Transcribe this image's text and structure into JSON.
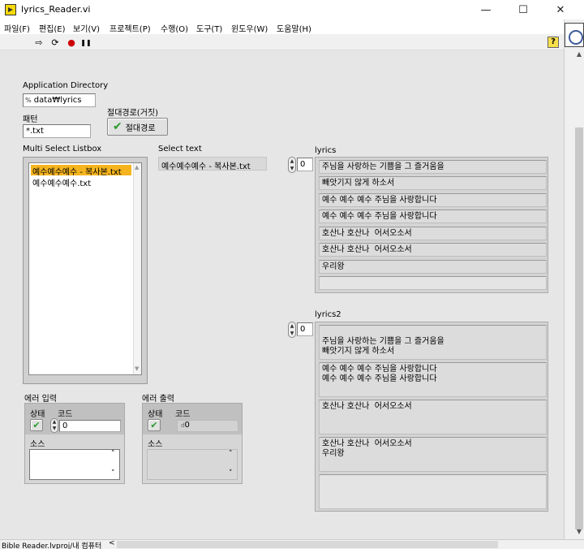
{
  "window": {
    "title": "lyrics_Reader.vi",
    "minimize": "—",
    "maximize": "☐",
    "close": "✕"
  },
  "menu": [
    "파일(F)",
    "편집(E)",
    "보기(V)",
    "프로젝트(P)",
    "수행(O)",
    "도구(T)",
    "윈도우(W)",
    "도움말(H)"
  ],
  "toolbar": {
    "run": "⇨",
    "run_continuous": "⟳",
    "abort": "●",
    "pause": "❚❚"
  },
  "help": "?",
  "app_dir": {
    "label": "Application Directory",
    "path_icon": "%",
    "value": "data₩lyrics"
  },
  "absolute_path": {
    "label": "절대경로(거짓)",
    "button_text": "절대경로"
  },
  "pattern": {
    "label": "패턴",
    "value": "*.txt"
  },
  "listbox": {
    "label": "Multi Select Listbox",
    "items": [
      "예수예수예수 - 복사본.txt",
      "예수예수예수.txt"
    ],
    "selected_index": 0,
    "up": "▲",
    "down": "▼"
  },
  "select_text": {
    "label": "Select text",
    "value": "예수예수예수 - 복사본.txt"
  },
  "lyrics": {
    "label": "lyrics",
    "index": "0",
    "items": [
      "주님을 사랑하는 기쁨을 그 즐거움을",
      "빼앗기지 않게 하소서",
      "예수 예수 예수 주님을 사랑합니다",
      "예수 예수 예수 주님을 사랑합니다",
      "호산나 호산나  어서오소서",
      "호산나 호산나  어서오소서",
      "우리왕",
      ""
    ]
  },
  "lyrics2": {
    "label": "lyrics2",
    "index": "0",
    "items": [
      "\n주님을 사랑하는 기쁨을 그 즐거움을\n빼앗기지 않게 하소서",
      "예수 예수 예수 주님을 사랑합니다\n예수 예수 예수 주님을 사랑합니다",
      "호산나 호산나  어서오소서",
      "호산나 호산나  어서오소서\n우리왕",
      ""
    ]
  },
  "error_in": {
    "label": "에러 입력",
    "status_label": "상태",
    "code_label": "코드",
    "code_value": "0",
    "source_label": "소스",
    "scroll_up": "˄",
    "scroll_down": "˅"
  },
  "error_out": {
    "label": "에러 출력",
    "status_label": "상태",
    "code_label": "코드",
    "code_value": "0",
    "source_label": "소스",
    "scroll_up": "˄",
    "scroll_down": "˅"
  },
  "status_bar": {
    "project": "Bible Reader.lvproj/내 컴퓨터",
    "scroll_left": "<"
  },
  "scrollbar": {
    "up": "▲",
    "down": "▼"
  }
}
